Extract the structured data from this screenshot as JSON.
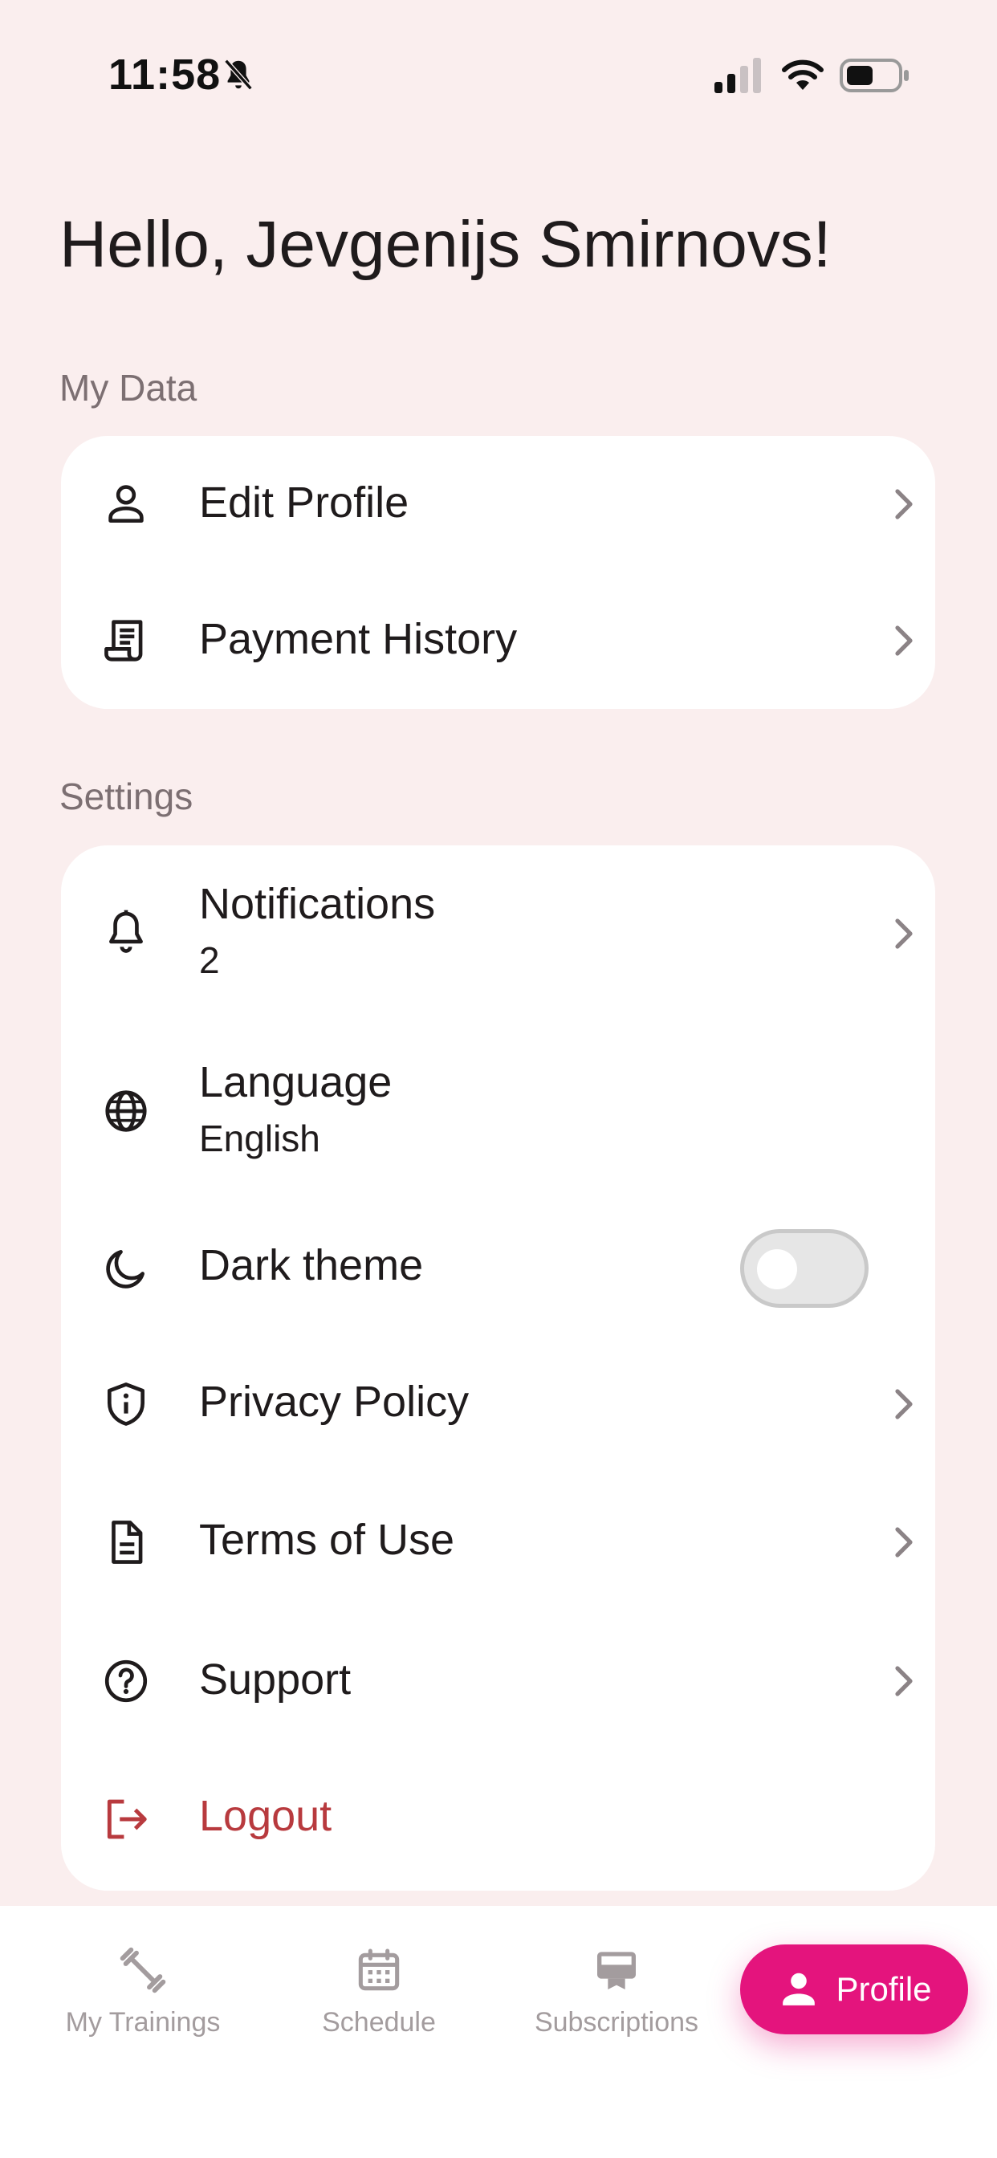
{
  "status_bar": {
    "time": "11:58",
    "icons": [
      "bell-off-icon",
      "signal-icon",
      "wifi-icon",
      "battery-icon"
    ]
  },
  "greeting": "Hello, Jevgenijs Smirnovs!",
  "my_data": {
    "label": "My Data",
    "items": [
      {
        "label": "Edit Profile",
        "icon": "person-icon"
      },
      {
        "label": "Payment History",
        "icon": "receipt-icon"
      }
    ]
  },
  "settings": {
    "label": "Settings",
    "items": [
      {
        "label": "Notifications",
        "sub": "2",
        "icon": "bell-icon"
      },
      {
        "label": "Language",
        "sub": "English",
        "icon": "globe-icon"
      },
      {
        "label": "Dark theme",
        "icon": "moon-icon",
        "toggle_on": false
      },
      {
        "label": "Privacy Policy",
        "icon": "shield-info-icon"
      },
      {
        "label": "Terms of Use",
        "icon": "document-icon"
      },
      {
        "label": "Support",
        "icon": "question-icon"
      },
      {
        "label": "Logout",
        "icon": "logout-icon"
      }
    ]
  },
  "bottom_nav": {
    "items": [
      {
        "label": "My Trainings",
        "icon": "dumbbell-icon"
      },
      {
        "label": "Schedule",
        "icon": "calendar-icon"
      },
      {
        "label": "Subscriptions",
        "icon": "subscription-card-icon"
      },
      {
        "label": "Profile",
        "icon": "person-icon",
        "active": true
      }
    ]
  },
  "colors": {
    "background": "#faeeee",
    "card": "#ffffff",
    "accent": "#e4147d",
    "logout": "#b83a3e",
    "muted_text": "#7c6f72",
    "nav_inactive": "#a39c9e"
  }
}
